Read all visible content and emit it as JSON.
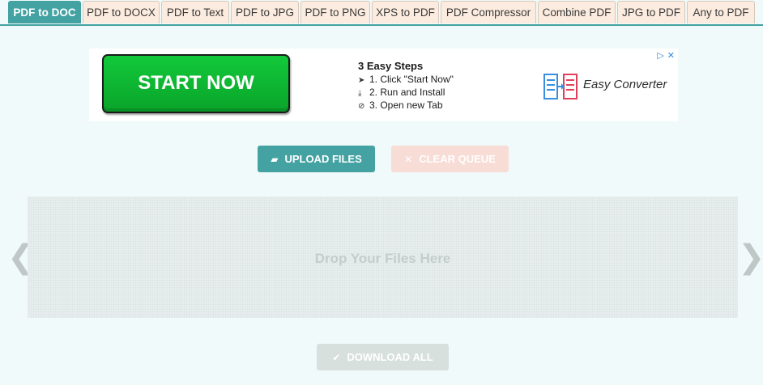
{
  "tabs": [
    {
      "label": "PDF to DOC",
      "active": true
    },
    {
      "label": "PDF to DOCX"
    },
    {
      "label": "PDF to Text"
    },
    {
      "label": "PDF to JPG"
    },
    {
      "label": "PDF to PNG"
    },
    {
      "label": "XPS to PDF"
    },
    {
      "label": "PDF Compressor"
    },
    {
      "label": "Combine PDF"
    },
    {
      "label": "JPG to PDF"
    },
    {
      "label": "Any to PDF"
    }
  ],
  "ad": {
    "start_button": "START NOW",
    "steps_title": "3 Easy Steps",
    "steps": [
      "1. Click \"Start Now\"",
      "2. Run and Install",
      "3. Open new Tab"
    ],
    "brand": "Easy Converter",
    "colors": {
      "start": "#0fb532",
      "brand": "#3a8ee0"
    }
  },
  "actions": {
    "upload_label": "UPLOAD FILES",
    "clear_label": "CLEAR QUEUE",
    "download_label": "DOWNLOAD ALL"
  },
  "dropzone": {
    "text": "Drop Your Files Here"
  },
  "nav": {
    "prev": "❮",
    "next": "❯"
  },
  "colors": {
    "accent": "#44a2a2",
    "tab_bg": "#fcecdf",
    "page_bg": "#f0fafa"
  }
}
